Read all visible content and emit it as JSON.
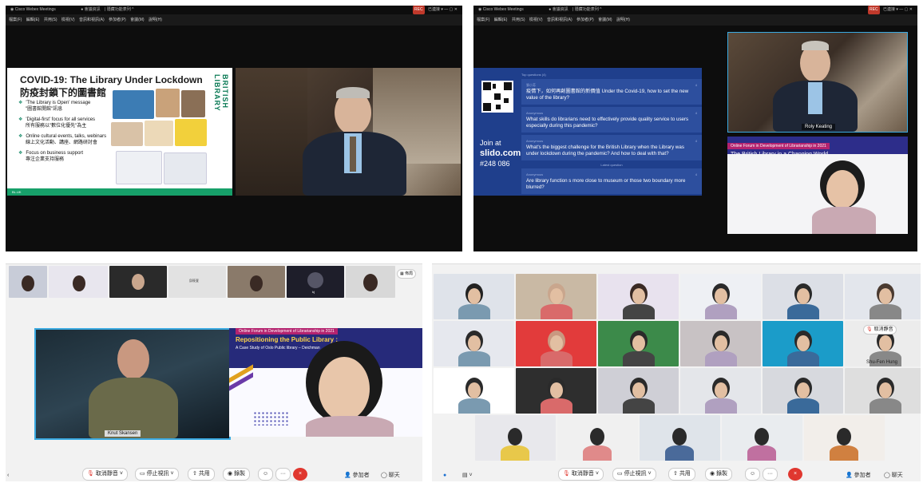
{
  "top_left": {
    "app_title": "Cisco Webex Meetings",
    "indicator1": "● 會議資訊",
    "indicator2": "| 隱藏功能表列 ^",
    "rec": "REC",
    "status": "已連接 ▾",
    "menus": [
      "檔案(F)",
      "編輯(E)",
      "共用(S)",
      "檢視(V)",
      "音訊和視訊(A)",
      "參加者(P)",
      "會議(M)",
      "說明(H)"
    ],
    "slide": {
      "title": "COVID-19: The Library Under Lockdown",
      "title_zh": "防疫封鎖下的圖書館",
      "bullets": [
        {
          "en": "'The Library is Open' message",
          "zh": "\"圖書館開館\"訊息"
        },
        {
          "en": "'Digital-first' focus for all services",
          "zh": "所有服務以\"數位化優先\"為主"
        },
        {
          "en": "Online cultural events, talks, webinars",
          "zh": "線上文化活動、講座、網路研討會"
        },
        {
          "en": "Focus on business support",
          "zh": "專注企業支持服務"
        }
      ],
      "logo": "BRITISH LIBRARY",
      "footer": "BL.UK"
    }
  },
  "top_right": {
    "app_title": "Cisco Webex Meetings",
    "indicator1": "● 會議資訊",
    "indicator2": "| 隱藏功能表列 ^",
    "rec": "REC",
    "status": "已連接 ▾",
    "menus": [
      "檔案(F)",
      "編輯(E)",
      "共用(S)",
      "檢視(V)",
      "音訊和視訊(A)",
      "參加者(P)",
      "會議(M)",
      "說明(H)"
    ],
    "slido": {
      "join": "Join at",
      "site": "slido.com",
      "code": "#248 086",
      "header": "Top questions (4)",
      "latest": "Latest question",
      "questions": [
        {
          "who": "張小芳",
          "likes": "4",
          "text": "疫情下，如何再創圖書館的新價值 Under the Covid-19, how to set the new value of the library?"
        },
        {
          "who": "Anonymous",
          "likes": "4",
          "text": "What skills do librarians need to effectively provide quality service to users especially during this pandemic?"
        },
        {
          "who": "Anonymous",
          "likes": "4",
          "text": "What's the biggest challenge for the British Library when the Library was under lockdown during the pandemic? And how to deal with that?"
        },
        {
          "who": "Anonymous",
          "likes": "4",
          "text": "Are library function s more close to museum or those two boundary more blurred?"
        }
      ]
    },
    "speaker_name": "Roly Keating",
    "forum_tag": "Online Forum in Development of Librarianship in 2021",
    "forum_title": "The British Library in a Changing World"
  },
  "bottom_left": {
    "thumb_name_1": "邱筱萱",
    "thumb_name_2": "kj",
    "layout_btn": "佈局",
    "speaker_name": "Knut Skansen",
    "forum_tag": "Online Forum in Development of Librarianship in 2021",
    "slide_title": "Repositioning the Public Library :",
    "slide_subtitle": "A Case Study of Oslo Public library – Deichman",
    "controls": {
      "mute": "取消靜音",
      "video": "停止視訊",
      "share": "共用",
      "record": "錄製",
      "participants": "參加者",
      "chat": "聊天",
      "more": "···",
      "end": "×"
    }
  },
  "bottom_right": {
    "unmute_tip": "取消靜音",
    "name_label": "Shu-Fen Hung",
    "controls": {
      "mute": "取消靜音",
      "video": "停止視訊",
      "share": "共用",
      "record": "錄製",
      "participants": "參加者",
      "chat": "聊天",
      "more": "···",
      "end": "×"
    }
  },
  "colors": {
    "webex_bg": "#0d0d0d",
    "slido_blue": "#1f3f8c",
    "bl_green": "#17a06a",
    "end_red": "#e0372f",
    "forum_magenta": "#b4236f"
  }
}
